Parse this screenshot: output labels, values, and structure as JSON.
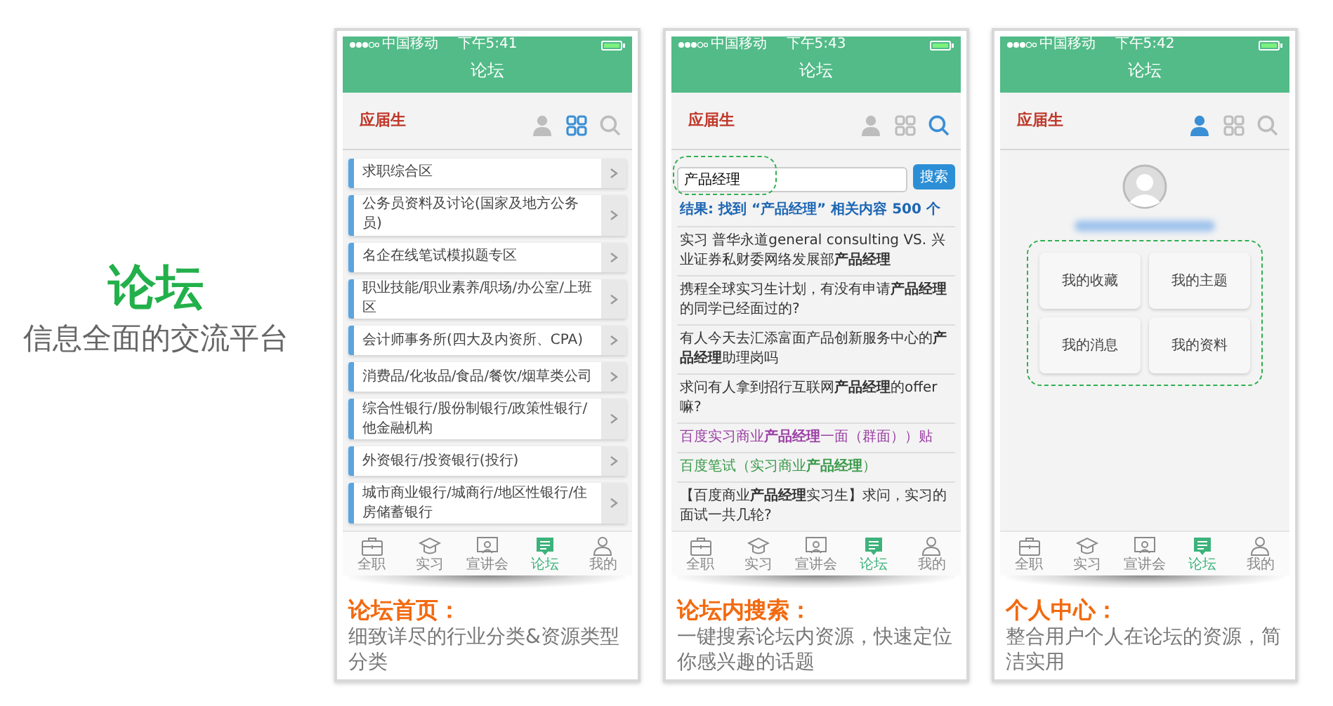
{
  "intro": {
    "title": "论坛",
    "subtitle": "信息全面的交流平台"
  },
  "screens": [
    {
      "kind": "categories",
      "status": {
        "carrier": "中国移动",
        "time": "下午5:41"
      },
      "title": "论坛",
      "logo": "应届生",
      "header_tabs": [
        {
          "selected": false
        },
        {
          "selected": true
        },
        {
          "selected": false
        }
      ],
      "categories": [
        "求职综合区",
        "公务员资料及讨论(国家及地方公务员)",
        "名企在线笔试模拟题专区",
        "职业技能/职业素养/职场/办公室/上班区",
        "会计师事务所(四大及内资所、CPA)",
        "消费品/化妆品/食品/餐饮/烟草类公司",
        "综合性银行/股份制银行/政策性银行/他金融机构",
        "外资银行/投资银行(投行)",
        "城市商业银行/城商行/地区性银行/住房储蓄银行"
      ],
      "tab_bar": [
        {
          "label": "全职",
          "selected": false
        },
        {
          "label": "实习",
          "selected": false
        },
        {
          "label": "宣讲会",
          "selected": false
        },
        {
          "label": "论坛",
          "selected": true
        },
        {
          "label": "我的",
          "selected": false
        }
      ],
      "caption": {
        "title": "论坛首页：",
        "text": "细致详尽的行业分类&资源类型分类"
      }
    },
    {
      "kind": "search",
      "status": {
        "carrier": "中国移动",
        "time": "下午5:43"
      },
      "title": "论坛",
      "logo": "应届生",
      "header_tabs": [
        {
          "selected": false
        },
        {
          "selected": false
        },
        {
          "selected": true
        }
      ],
      "search": {
        "value": "产品经理",
        "button": "搜索"
      },
      "result_summary": "结果: 找到 “产品经理” 相关内容 500 个",
      "results": [
        {
          "text": "实习 普华永道general consulting VS. 兴业证券私财委网络发展部**产品经理**",
          "color": "#333333"
        },
        {
          "text": "携程全球实习生计划，有没有申请**产品经理**的同学已经面过的?",
          "color": "#333333"
        },
        {
          "text": "有人今天去汇添富面产品创新服务中心的**产品经理**助理岗吗",
          "color": "#333333"
        },
        {
          "text": "求问有人拿到招行互联网**产品经理**的offer嘛?",
          "color": "#333333"
        },
        {
          "text": "百度实习商业**产品经理**一面（群面））贴",
          "color": "#9b3fa5"
        },
        {
          "text": "百度笔试（实习商业**产品经理**）",
          "color": "#3a9a4a"
        },
        {
          "text": "【百度商业**产品经理**实习生】求问，实习的面试一共几轮?",
          "color": "#333333"
        }
      ],
      "tab_bar": [
        {
          "label": "全职",
          "selected": false
        },
        {
          "label": "实习",
          "selected": false
        },
        {
          "label": "宣讲会",
          "selected": false
        },
        {
          "label": "论坛",
          "selected": true
        },
        {
          "label": "我的",
          "selected": false
        }
      ],
      "caption": {
        "title": "论坛内搜索：",
        "text": "一键搜索论坛内资源，快速定位你感兴趣的话题"
      }
    },
    {
      "kind": "profile",
      "status": {
        "carrier": "中国移动",
        "time": "下午5:42"
      },
      "title": "论坛",
      "logo": "应届生",
      "header_tabs": [
        {
          "selected": true
        },
        {
          "selected": false
        },
        {
          "selected": false
        }
      ],
      "menu": [
        "我的收藏",
        "我的主题",
        "我的消息",
        "我的资料"
      ],
      "tab_bar": [
        {
          "label": "全职",
          "selected": false
        },
        {
          "label": "实习",
          "selected": false
        },
        {
          "label": "宣讲会",
          "selected": false
        },
        {
          "label": "论坛",
          "selected": true
        },
        {
          "label": "我的",
          "selected": false
        }
      ],
      "caption": {
        "title": "个人中心：",
        "text": "整合用户个人在论坛的资源，简洁实用"
      }
    }
  ]
}
